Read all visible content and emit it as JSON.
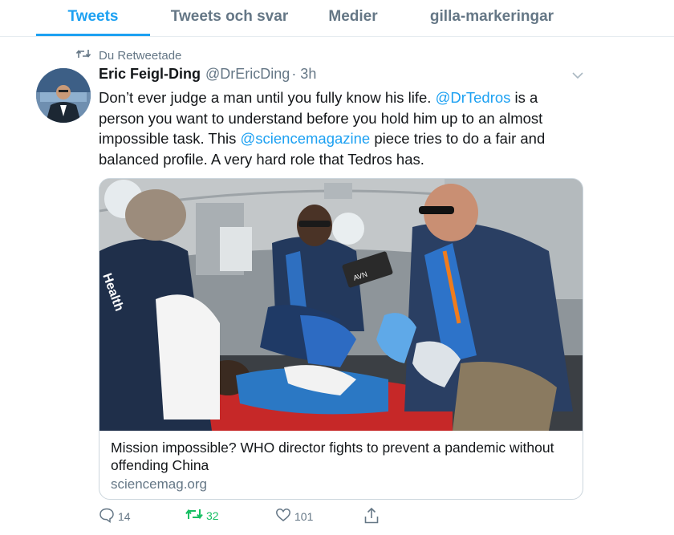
{
  "tabs": [
    {
      "label": "Tweets",
      "active": true
    },
    {
      "label": "Tweets och svar",
      "active": false
    },
    {
      "label": "Medier",
      "active": false
    },
    {
      "label": "gilla-markeringar",
      "active": false
    }
  ],
  "retweet_context": {
    "label": "Du Retweetade",
    "icon": "retweet-icon"
  },
  "tweet": {
    "display_name": "Eric Feigl-Ding",
    "handle": "@DrEricDing",
    "time": "· 3h",
    "text": {
      "part1": "Don’t ever judge a man until you fully know his life. ",
      "mention1": "@DrTedros",
      "part2": " is a person you want to understand before you hold him up to an almost impossible task. This ",
      "mention2": "@sciencemagazine",
      "part3": " piece tries to do a fair and balanced profile. A very hard role that Tedros has."
    },
    "card": {
      "title": "Mission impossible? WHO director fights to prevent a pandemic without offending China",
      "domain": "sciencemag.org",
      "image_labels": {
        "sleeve": "Health",
        "device": "AVN"
      }
    },
    "actions": {
      "replies": "14",
      "retweets": "32",
      "likes": "101"
    }
  },
  "colors": {
    "accent": "#1da1f2",
    "retweet_active": "#17bf63",
    "muted": "#657786",
    "text": "#14171a",
    "divider": "#e6ecf0"
  }
}
